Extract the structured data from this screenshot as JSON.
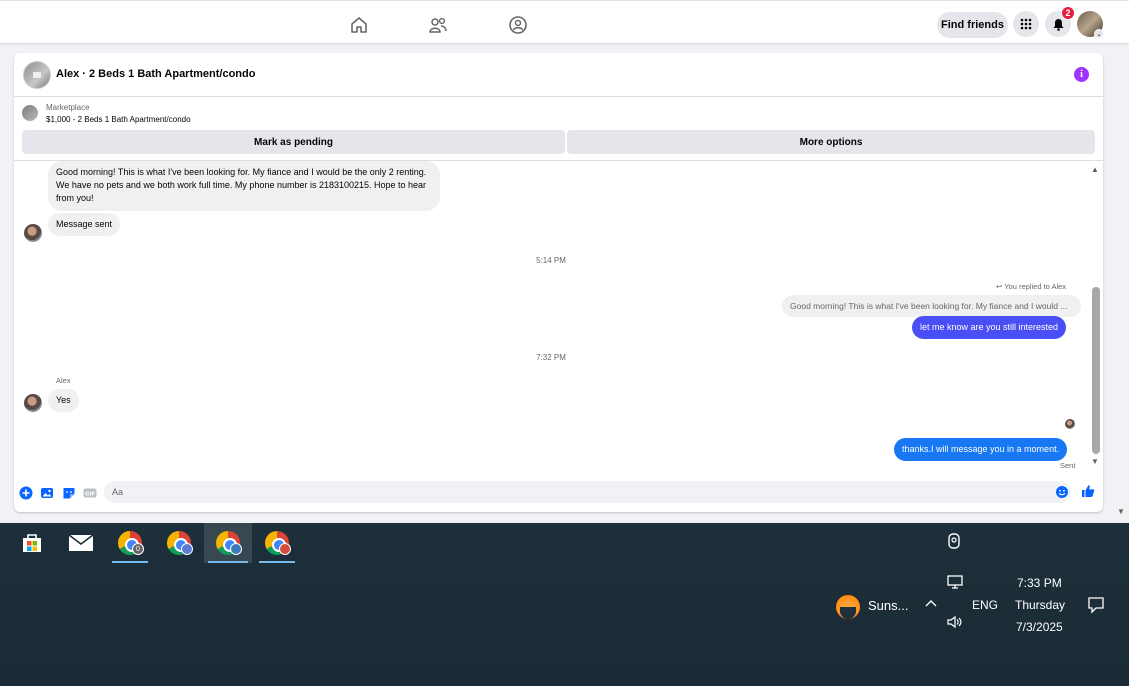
{
  "topbar": {
    "nav_icons": [
      "home-icon",
      "friends-icon",
      "groups-icon"
    ],
    "find_friends_label": "Find friends",
    "notification_count": "2"
  },
  "chat": {
    "title": "Alex · 2 Beds 1 Bath Apartment/condo",
    "marketplace_label": "Marketplace",
    "marketplace_listing": "$1,000 - 2 Beds 1 Bath Apartment/condo",
    "mark_pending_label": "Mark as pending",
    "more_options_label": "More options",
    "messages": {
      "incoming_1": "Good morning! This is what I've been looking for. My fiance and I would be the only 2 renting. We have no pets and we both work full time.  My phone number is 2183100215. Hope to hear from you!",
      "incoming_2": "Message sent",
      "time_1": "5:14 PM",
      "replied_label": "You replied to Alex",
      "quoted": "Good morning! This is what I've been looking for. My fiance and I would ...",
      "outgoing_1": "let me know are you still interested",
      "time_2": "7:32 PM",
      "sender_name": "Alex",
      "incoming_3": "Yes",
      "outgoing_2": "thanks.I will message you in a moment.",
      "status": "Sent"
    },
    "composer": {
      "placeholder": "Aa"
    }
  },
  "taskbar": {
    "apps": [
      "store-icon",
      "mail-icon",
      "chrome-profile-0",
      "chrome-profile-1",
      "chrome-profile-2",
      "chrome-profile-3"
    ],
    "chrome_badge_0": "0",
    "weather_label": "Suns...",
    "language": "ENG",
    "time": "7:33 PM",
    "day": "Thursday",
    "date": "7/3/2025"
  },
  "colors": {
    "accent": "#0084ff",
    "badge": "#e41e3f",
    "info": "#a033ff"
  }
}
